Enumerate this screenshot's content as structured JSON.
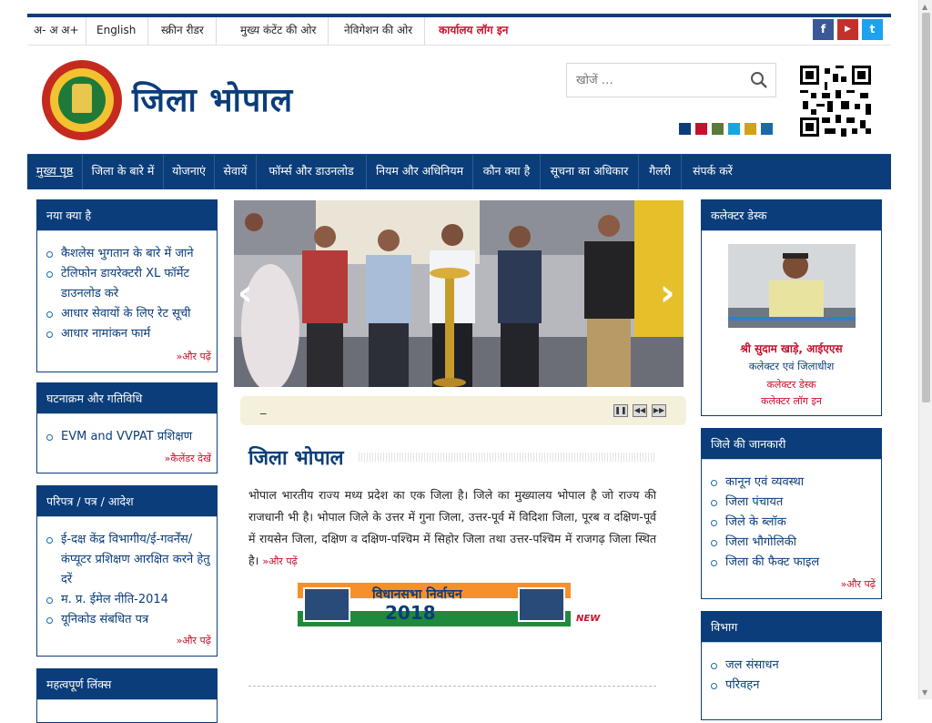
{
  "topbar": {
    "font_size": "अ- अ अ+",
    "english": "English",
    "screen_reader": "स्क्रीन रीडर",
    "main_content": "मुख्य कंटेंट की ओर",
    "navigation": "नेविगेशन की ओर",
    "office_login": "कार्यालय लॉग इन",
    "social": [
      {
        "icon": "facebook-icon",
        "glyph": "f",
        "color": "#3b5998"
      },
      {
        "icon": "youtube-icon",
        "glyph": "▶",
        "color": "#c4302b"
      },
      {
        "icon": "twitter-icon",
        "glyph": "t",
        "color": "#1da1f2"
      }
    ]
  },
  "header": {
    "site_title": "जिला भोपाल",
    "search_placeholder": "खोजें …",
    "theme_colors": [
      "#0a3d7a",
      "#c8102e",
      "#5a7a3a",
      "#11a8e0",
      "#d4a017",
      "#1a6aa8"
    ]
  },
  "nav": {
    "items": [
      {
        "label": "मुख्य पृष्ठ",
        "active": true
      },
      {
        "label": "जिला के बारे में"
      },
      {
        "label": "योजनाएं"
      },
      {
        "label": "सेवायें"
      },
      {
        "label": "फॉर्म्स और डाउनलोड"
      },
      {
        "label": "नियम और अधिनियम"
      },
      {
        "label": "कौन क्या है"
      },
      {
        "label": "सूचना का अधिकार"
      },
      {
        "label": "गैलरी"
      },
      {
        "label": "संपर्क करें"
      }
    ]
  },
  "left": {
    "whats_new": {
      "title": "नया क्या है",
      "items": [
        "कैशलेस भुगतान के बारे में जाने",
        "टेलिफोन डायरेक्टरी XL फॉर्मेट डाउनलोड करे",
        "आधार सेवायों के लिए रेट सूची",
        "आधार नामांकन फार्म"
      ],
      "more": "»और पढ़ें"
    },
    "events": {
      "title": "घटनाक्रम और गतिविधि",
      "items": [
        "EVM and VVPAT प्रशिक्षण"
      ],
      "more": "»कैलेंडर देखें"
    },
    "circulars": {
      "title": "परिपत्र / पत्र / आदेश",
      "items": [
        "ई-दक्ष केंद्र विभागीय/ई-गवर्नेंस/ कंप्यूटर प्रशिक्षण आरक्षित करने हेतु दरें",
        "म. प्र. ईमेल नीति-2014",
        "यूनिकोड संबधित पत्र"
      ],
      "more": "»और पढ़ें"
    },
    "links": {
      "title": "महत्वपूर्ण लिंक्स"
    }
  },
  "center": {
    "ticker_text": "_",
    "title": "जिला भोपाल",
    "intro": "भोपाल भारतीय राज्य मध्य प्रदेश का एक जिला है। जिले का मुख्यालय भोपाल है जो राज्य की राजधानी भी है। भोपाल जिले के उत्तर में गुना जिला, उत्तर-पूर्व में विदिशा जिला, पूरब व दक्षिण-पूर्व में रायसेन जिला, दक्षिण व दक्षिण-पश्चिम में सिहोर जिला तथा उत्तर-पश्चिम में राजगढ़ जिला स्थित है।",
    "intro_more": "»और पढ़ें",
    "banner_line1": "विधानसभा निर्वाचन",
    "banner_line2": "2018",
    "new_tag": "NEW"
  },
  "right": {
    "collector": {
      "title": "कलेक्टर डेस्क",
      "name": "श्री सुदाम खाड़े, आईएएस",
      "designation": "कलेक्टर एवं जिलाधीश",
      "desk_link": "कलेक्टर डेस्क",
      "login_link": "कलेक्टर लॉग इन"
    },
    "district_info": {
      "title": "जिले की जानकारी",
      "items": [
        "कानून एवं व्यवस्था",
        "जिला पंचायत",
        "जिले के ब्लॉक",
        "जिला भौगोलिकी",
        "जिला की फैक्ट फाइल"
      ],
      "more": "»और पढ़ें"
    },
    "departments": {
      "title": "विभाग",
      "items": [
        "जल संसाधन",
        "परिवहन"
      ]
    }
  }
}
